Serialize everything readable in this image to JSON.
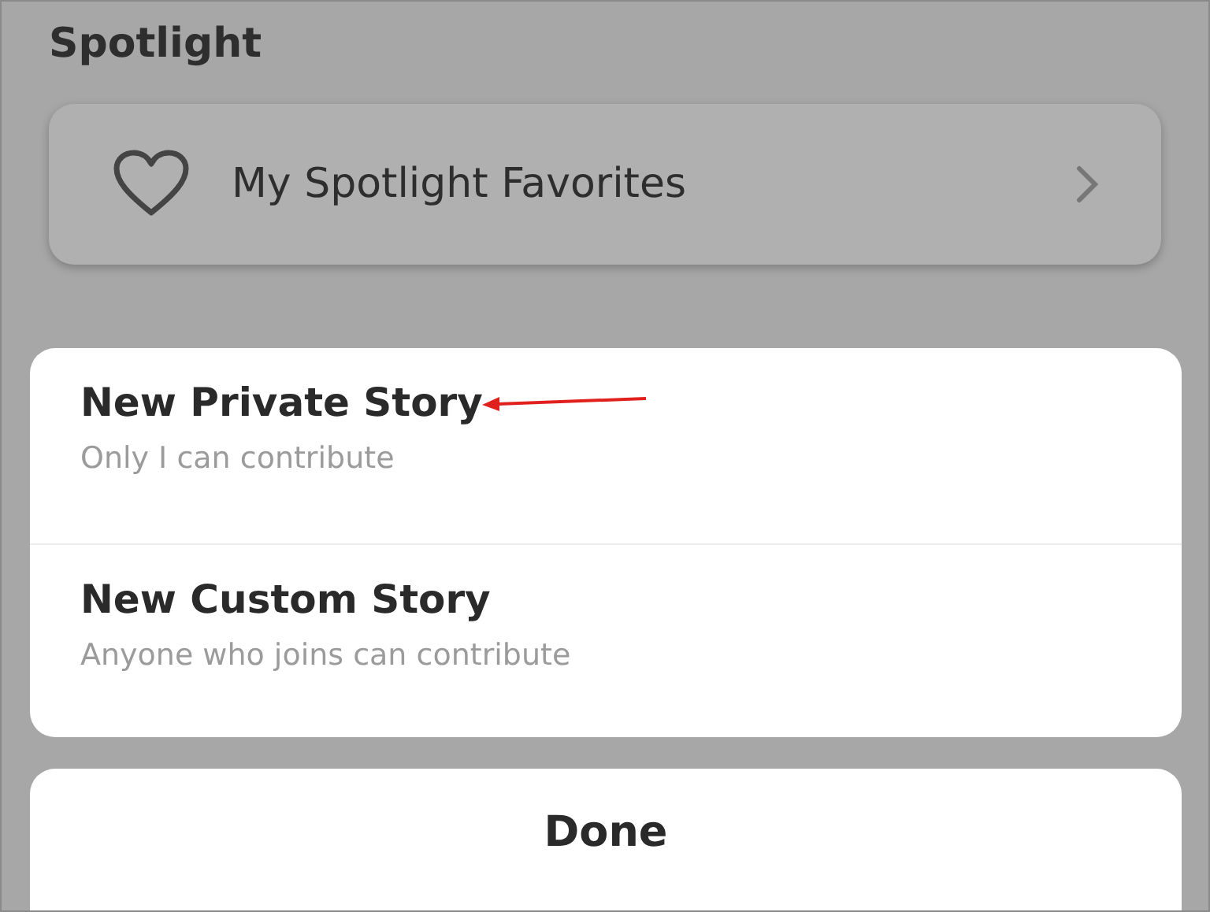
{
  "section_title": "Spotlight",
  "favorites_row": {
    "label": "My Spotlight Favorites"
  },
  "sheet": {
    "options": [
      {
        "title": "New Private Story",
        "subtitle": "Only I can contribute",
        "annotated": true
      },
      {
        "title": "New Custom Story",
        "subtitle": "Anyone who joins can contribute",
        "annotated": false
      }
    ]
  },
  "done_button": {
    "label": "Done"
  }
}
